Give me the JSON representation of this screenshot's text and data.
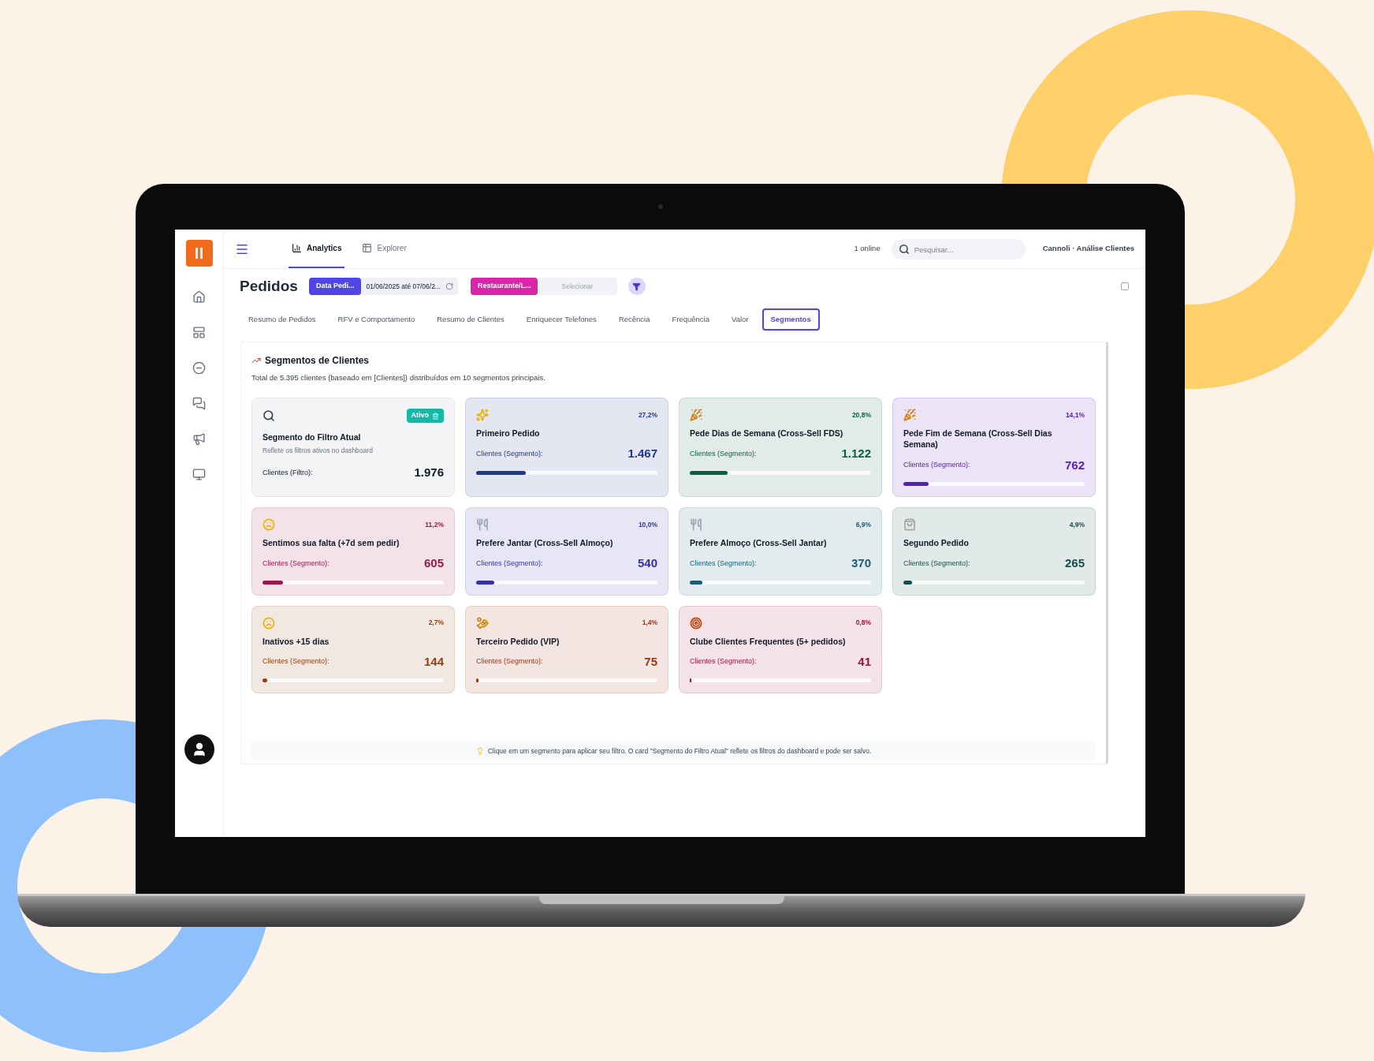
{
  "topbar": {
    "nav": [
      {
        "label": "Analytics",
        "selected": true
      },
      {
        "label": "Explorer",
        "selected": false
      }
    ],
    "status": "1 online",
    "search": {
      "placeholder": "Pesquisar..."
    },
    "workspace": "Cannoli · Análise Clientes"
  },
  "page": {
    "title": "Pedidos",
    "filters": [
      {
        "kind": "date",
        "label": "Data Pedi...",
        "value": "01/06/2025 até 07/06/2...",
        "color": "#4f46e5"
      },
      {
        "kind": "select",
        "label": "Restaurante/L...",
        "placeholder": "Selecionar",
        "color": "#d926a9"
      }
    ]
  },
  "tabs": [
    {
      "label": "Resumo de Pedidos",
      "selected": false
    },
    {
      "label": "RFV e Comportamento",
      "selected": false
    },
    {
      "label": "Resumo de Clientes",
      "selected": false
    },
    {
      "label": "Enriquecer Telefones",
      "selected": false
    },
    {
      "label": "Recência",
      "selected": false
    },
    {
      "label": "Frequência",
      "selected": false
    },
    {
      "label": "Valor",
      "selected": false
    },
    {
      "label": "Segmentos",
      "selected": true
    }
  ],
  "segments": {
    "title": "Segmentos de Clientes",
    "subtitle": "Total de 5.395 clientes (baseado em [Clientes]) distribuídos em 10 segmentos principais.",
    "cards": [
      {
        "kind": "filter",
        "badge": "Ativo",
        "title": "Segmento do Filtro Atual",
        "note": "Reflete os filtros ativos no dashboard",
        "label": "Clientes (Filtro):",
        "value": "1.976"
      },
      {
        "kind": "segment",
        "share": "27,2%",
        "title": "Primeiro Pedido",
        "label": "Clientes (Segmento):",
        "value": "1.467",
        "level": 0.272,
        "color": "#1e3a8a"
      },
      {
        "kind": "segment",
        "share": "20,8%",
        "title": "Pede Dias de Semana (Cross-Sell FDS)",
        "label": "Clientes (Segmento):",
        "value": "1.122",
        "level": 0.208,
        "color": "#065f46"
      },
      {
        "kind": "segment",
        "share": "14,1%",
        "title": "Pede Fim de Semana (Cross-Sell Dias Semana)",
        "label": "Clientes (Segmento):",
        "value": "762",
        "level": 0.141,
        "color": "#5b21b6"
      },
      {
        "kind": "segment",
        "share": "11,2%",
        "title": "Sentimos sua falta (+7d sem pedir)",
        "label": "Clientes (Segmento):",
        "value": "605",
        "level": 0.112,
        "color": "#9d174d"
      },
      {
        "kind": "segment",
        "share": "10,0%",
        "title": "Prefere Jantar (Cross-Sell Almoço)",
        "label": "Clientes (Segmento):",
        "value": "540",
        "level": 0.1,
        "color": "#3730a3"
      },
      {
        "kind": "segment",
        "share": "6,9%",
        "title": "Prefere Almoço (Cross-Sell Jantar)",
        "label": "Clientes (Segmento):",
        "value": "370",
        "level": 0.069,
        "color": "#155e75"
      },
      {
        "kind": "segment",
        "share": "4,9%",
        "title": "Segundo Pedido",
        "label": "Clientes (Segmento):",
        "value": "265",
        "level": 0.049,
        "color": "#134e4a"
      },
      {
        "kind": "segment",
        "share": "2,7%",
        "title": "Inativos +15 dias",
        "label": "Clientes (Segmento):",
        "value": "144",
        "level": 0.027,
        "color": "#92400e"
      },
      {
        "kind": "segment",
        "share": "1,4%",
        "title": "Terceiro Pedido (VIP)",
        "label": "Clientes (Segmento):",
        "value": "75",
        "level": 0.014,
        "color": "#9a3412"
      },
      {
        "kind": "segment",
        "share": "0,8%",
        "title": "Clube Clientes Frequentes (5+ pedidos)",
        "label": "Clientes (Segmento):",
        "value": "41",
        "level": 0.008,
        "color": "#9f1239"
      }
    ],
    "hint": "Clique em um segmento para aplicar seu filtro. O card \"Segmento do Filtro Atual\" reflete os filtros do dashboard e pode ser salvo."
  }
}
